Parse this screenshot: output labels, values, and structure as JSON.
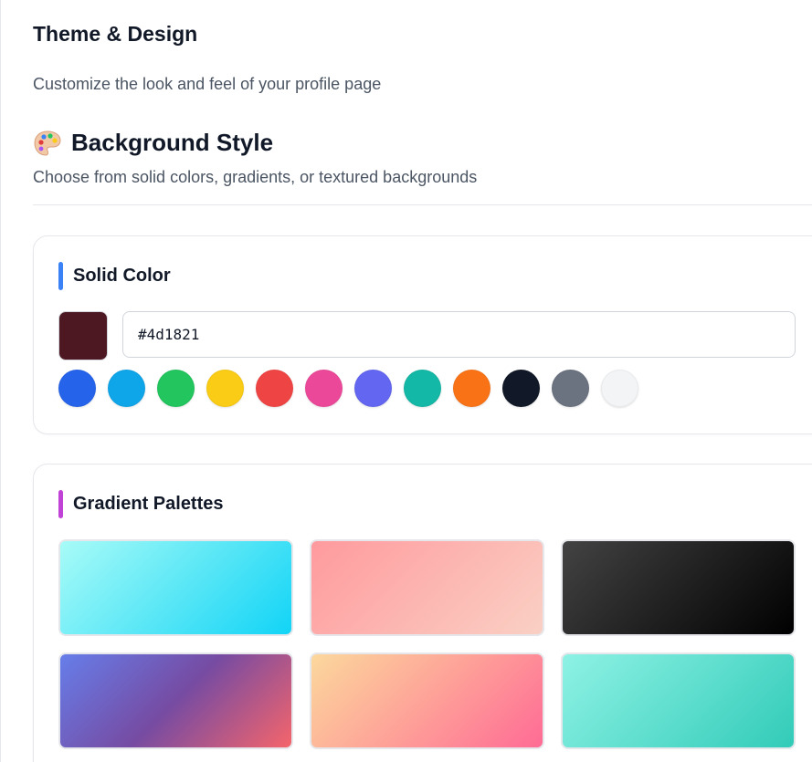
{
  "page": {
    "title": "Theme & Design",
    "subtitle": "Customize the look and feel of your profile page"
  },
  "background_section": {
    "icon": "palette-icon",
    "title": "Background Style",
    "description": "Choose from solid colors, gradients, or textured backgrounds"
  },
  "solid_color": {
    "title": "Solid Color",
    "accent_color": "#3b82f6",
    "current_value": "#4d1821",
    "preview_color": "#4d1821",
    "swatches": [
      "#2563eb",
      "#0ea5e9",
      "#22c55e",
      "#facc15",
      "#ef4444",
      "#ec4899",
      "#6366f1",
      "#14b8a6",
      "#f97316",
      "#111827",
      "#6b7280",
      "#f3f4f6"
    ]
  },
  "gradient_palettes": {
    "title": "Gradient Palettes",
    "accent_color": "#c142d6",
    "gradients": [
      {
        "from": "#a8fbf7",
        "to": "#12d4f6"
      },
      {
        "from": "#ff9a9e",
        "to": "#fad0c4"
      },
      {
        "from": "#434343",
        "to": "#000000"
      },
      {
        "from": "#667eea",
        "via": "#764ba2",
        "to": "#f5656b"
      },
      {
        "from": "#fcd89c",
        "to": "#ff6b95"
      },
      {
        "from": "#8ef2e5",
        "to": "#32cbb8"
      }
    ]
  }
}
